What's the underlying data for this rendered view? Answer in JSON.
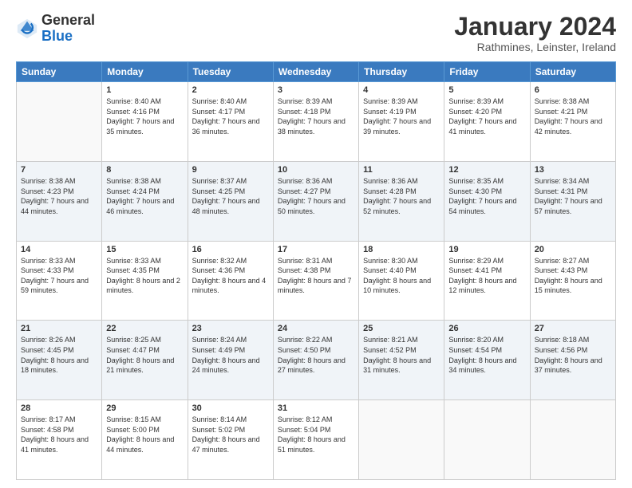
{
  "logo": {
    "general": "General",
    "blue": "Blue"
  },
  "header": {
    "month": "January 2024",
    "location": "Rathmines, Leinster, Ireland"
  },
  "days_of_week": [
    "Sunday",
    "Monday",
    "Tuesday",
    "Wednesday",
    "Thursday",
    "Friday",
    "Saturday"
  ],
  "weeks": [
    [
      {
        "day": "",
        "sunrise": "",
        "sunset": "",
        "daylight": ""
      },
      {
        "day": "1",
        "sunrise": "Sunrise: 8:40 AM",
        "sunset": "Sunset: 4:16 PM",
        "daylight": "Daylight: 7 hours and 35 minutes."
      },
      {
        "day": "2",
        "sunrise": "Sunrise: 8:40 AM",
        "sunset": "Sunset: 4:17 PM",
        "daylight": "Daylight: 7 hours and 36 minutes."
      },
      {
        "day": "3",
        "sunrise": "Sunrise: 8:39 AM",
        "sunset": "Sunset: 4:18 PM",
        "daylight": "Daylight: 7 hours and 38 minutes."
      },
      {
        "day": "4",
        "sunrise": "Sunrise: 8:39 AM",
        "sunset": "Sunset: 4:19 PM",
        "daylight": "Daylight: 7 hours and 39 minutes."
      },
      {
        "day": "5",
        "sunrise": "Sunrise: 8:39 AM",
        "sunset": "Sunset: 4:20 PM",
        "daylight": "Daylight: 7 hours and 41 minutes."
      },
      {
        "day": "6",
        "sunrise": "Sunrise: 8:38 AM",
        "sunset": "Sunset: 4:21 PM",
        "daylight": "Daylight: 7 hours and 42 minutes."
      }
    ],
    [
      {
        "day": "7",
        "sunrise": "Sunrise: 8:38 AM",
        "sunset": "Sunset: 4:23 PM",
        "daylight": "Daylight: 7 hours and 44 minutes."
      },
      {
        "day": "8",
        "sunrise": "Sunrise: 8:38 AM",
        "sunset": "Sunset: 4:24 PM",
        "daylight": "Daylight: 7 hours and 46 minutes."
      },
      {
        "day": "9",
        "sunrise": "Sunrise: 8:37 AM",
        "sunset": "Sunset: 4:25 PM",
        "daylight": "Daylight: 7 hours and 48 minutes."
      },
      {
        "day": "10",
        "sunrise": "Sunrise: 8:36 AM",
        "sunset": "Sunset: 4:27 PM",
        "daylight": "Daylight: 7 hours and 50 minutes."
      },
      {
        "day": "11",
        "sunrise": "Sunrise: 8:36 AM",
        "sunset": "Sunset: 4:28 PM",
        "daylight": "Daylight: 7 hours and 52 minutes."
      },
      {
        "day": "12",
        "sunrise": "Sunrise: 8:35 AM",
        "sunset": "Sunset: 4:30 PM",
        "daylight": "Daylight: 7 hours and 54 minutes."
      },
      {
        "day": "13",
        "sunrise": "Sunrise: 8:34 AM",
        "sunset": "Sunset: 4:31 PM",
        "daylight": "Daylight: 7 hours and 57 minutes."
      }
    ],
    [
      {
        "day": "14",
        "sunrise": "Sunrise: 8:33 AM",
        "sunset": "Sunset: 4:33 PM",
        "daylight": "Daylight: 7 hours and 59 minutes."
      },
      {
        "day": "15",
        "sunrise": "Sunrise: 8:33 AM",
        "sunset": "Sunset: 4:35 PM",
        "daylight": "Daylight: 8 hours and 2 minutes."
      },
      {
        "day": "16",
        "sunrise": "Sunrise: 8:32 AM",
        "sunset": "Sunset: 4:36 PM",
        "daylight": "Daylight: 8 hours and 4 minutes."
      },
      {
        "day": "17",
        "sunrise": "Sunrise: 8:31 AM",
        "sunset": "Sunset: 4:38 PM",
        "daylight": "Daylight: 8 hours and 7 minutes."
      },
      {
        "day": "18",
        "sunrise": "Sunrise: 8:30 AM",
        "sunset": "Sunset: 4:40 PM",
        "daylight": "Daylight: 8 hours and 10 minutes."
      },
      {
        "day": "19",
        "sunrise": "Sunrise: 8:29 AM",
        "sunset": "Sunset: 4:41 PM",
        "daylight": "Daylight: 8 hours and 12 minutes."
      },
      {
        "day": "20",
        "sunrise": "Sunrise: 8:27 AM",
        "sunset": "Sunset: 4:43 PM",
        "daylight": "Daylight: 8 hours and 15 minutes."
      }
    ],
    [
      {
        "day": "21",
        "sunrise": "Sunrise: 8:26 AM",
        "sunset": "Sunset: 4:45 PM",
        "daylight": "Daylight: 8 hours and 18 minutes."
      },
      {
        "day": "22",
        "sunrise": "Sunrise: 8:25 AM",
        "sunset": "Sunset: 4:47 PM",
        "daylight": "Daylight: 8 hours and 21 minutes."
      },
      {
        "day": "23",
        "sunrise": "Sunrise: 8:24 AM",
        "sunset": "Sunset: 4:49 PM",
        "daylight": "Daylight: 8 hours and 24 minutes."
      },
      {
        "day": "24",
        "sunrise": "Sunrise: 8:22 AM",
        "sunset": "Sunset: 4:50 PM",
        "daylight": "Daylight: 8 hours and 27 minutes."
      },
      {
        "day": "25",
        "sunrise": "Sunrise: 8:21 AM",
        "sunset": "Sunset: 4:52 PM",
        "daylight": "Daylight: 8 hours and 31 minutes."
      },
      {
        "day": "26",
        "sunrise": "Sunrise: 8:20 AM",
        "sunset": "Sunset: 4:54 PM",
        "daylight": "Daylight: 8 hours and 34 minutes."
      },
      {
        "day": "27",
        "sunrise": "Sunrise: 8:18 AM",
        "sunset": "Sunset: 4:56 PM",
        "daylight": "Daylight: 8 hours and 37 minutes."
      }
    ],
    [
      {
        "day": "28",
        "sunrise": "Sunrise: 8:17 AM",
        "sunset": "Sunset: 4:58 PM",
        "daylight": "Daylight: 8 hours and 41 minutes."
      },
      {
        "day": "29",
        "sunrise": "Sunrise: 8:15 AM",
        "sunset": "Sunset: 5:00 PM",
        "daylight": "Daylight: 8 hours and 44 minutes."
      },
      {
        "day": "30",
        "sunrise": "Sunrise: 8:14 AM",
        "sunset": "Sunset: 5:02 PM",
        "daylight": "Daylight: 8 hours and 47 minutes."
      },
      {
        "day": "31",
        "sunrise": "Sunrise: 8:12 AM",
        "sunset": "Sunset: 5:04 PM",
        "daylight": "Daylight: 8 hours and 51 minutes."
      },
      {
        "day": "",
        "sunrise": "",
        "sunset": "",
        "daylight": ""
      },
      {
        "day": "",
        "sunrise": "",
        "sunset": "",
        "daylight": ""
      },
      {
        "day": "",
        "sunrise": "",
        "sunset": "",
        "daylight": ""
      }
    ]
  ]
}
